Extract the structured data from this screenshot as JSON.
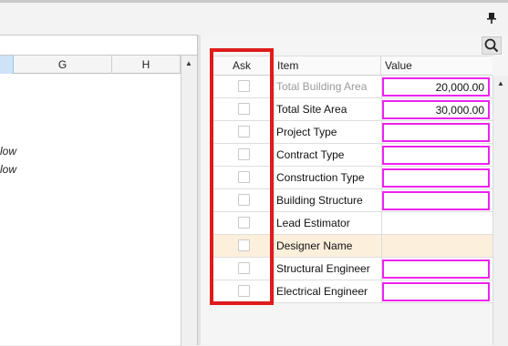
{
  "sheet": {
    "columns": [
      "G",
      "H"
    ],
    "cells": [
      "low",
      "low"
    ]
  },
  "panel": {
    "headers": {
      "ask": "Ask",
      "item": "Item",
      "value": "Value"
    },
    "rows": [
      {
        "item": "Total Building Area",
        "value": "20,000.00",
        "dim": true
      },
      {
        "item": "Total Site Area",
        "value": "30,000.00"
      },
      {
        "item": "Project Type",
        "value": ""
      },
      {
        "item": "Contract Type",
        "value": ""
      },
      {
        "item": "Construction Type",
        "value": ""
      },
      {
        "item": "Building Structure",
        "value": ""
      },
      {
        "item": "Lead Estimator",
        "value": ""
      },
      {
        "item": "Designer Name",
        "value": ""
      },
      {
        "item": "Structural Engineer",
        "value": ""
      },
      {
        "item": "Electrical Engineer",
        "value": ""
      }
    ]
  },
  "colors": {
    "highlight_box": "#e01b1b",
    "value_outline": "#ee22ee",
    "selected_row": "#fcefdc"
  },
  "icons": {
    "pin": "pin-icon",
    "search": "search-icon",
    "scroll_up": "scroll-up-arrow-icon"
  }
}
